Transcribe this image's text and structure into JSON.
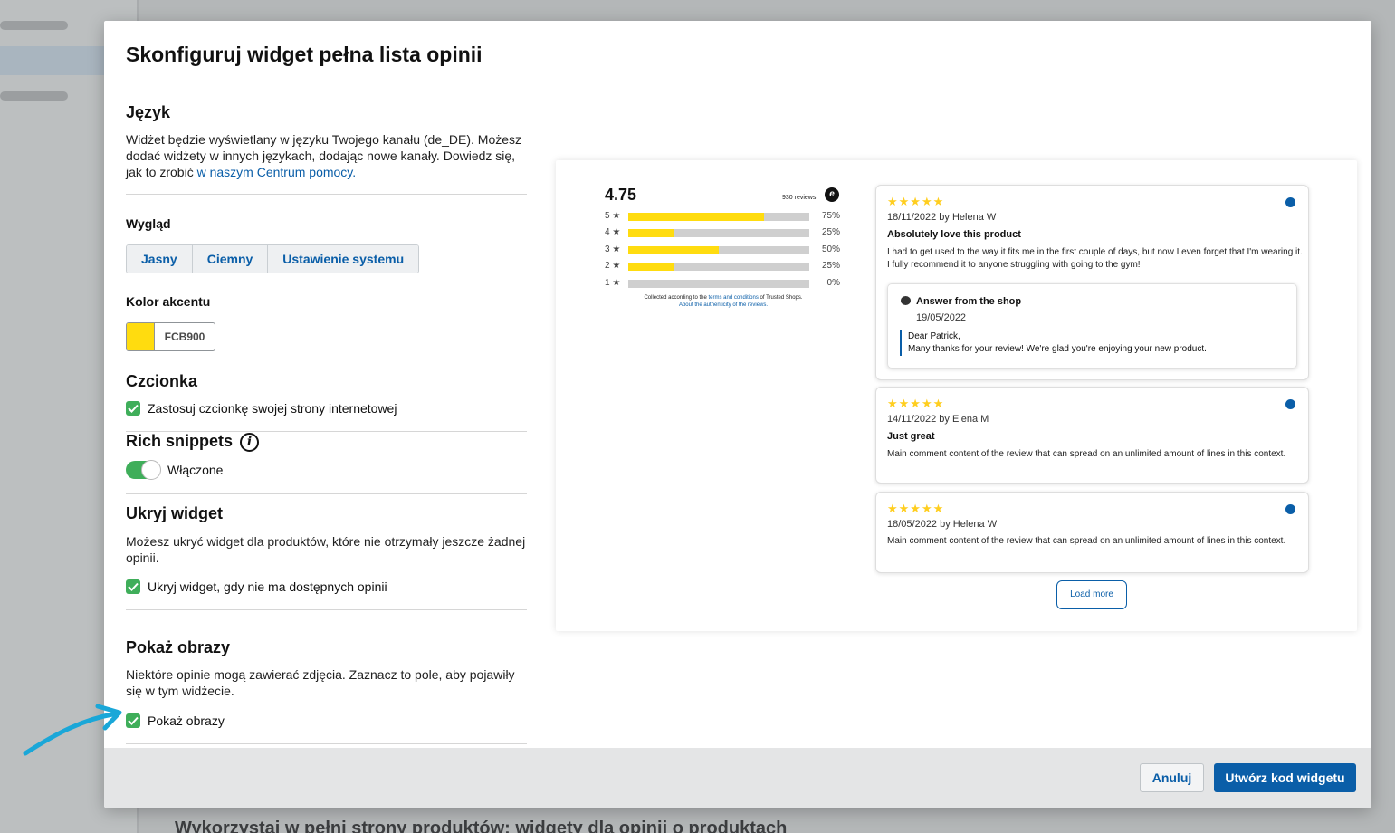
{
  "modal": {
    "title": "Skonfiguruj widget pełna lista opinii",
    "language": {
      "heading": "Język",
      "text": "Widżet będzie wyświetlany w języku Twojego kanału (de_DE). Możesz dodać widżety w innych językach, dodając nowe kanały. Dowiedz się, jak to zrobić ",
      "link": "w naszym Centrum pomocy."
    },
    "appearance": {
      "heading": "Wygląd",
      "options": [
        "Jasny",
        "Ciemny",
        "Ustawienie systemu"
      ]
    },
    "accent": {
      "heading": "Kolor akcentu",
      "value": "FCB900",
      "swatch_color": "#FCB900"
    },
    "font": {
      "heading": "Czcionka",
      "checkbox_label": "Zastosuj czcionkę swojej strony internetowej",
      "checked": true
    },
    "rich_snippets": {
      "heading": "Rich snippets",
      "info_icon": "info-icon",
      "toggle_label": "Włączone",
      "enabled": true
    },
    "hide_widget": {
      "heading": "Ukryj widget",
      "text": "Możesz ukryć widget dla produktów, które nie otrzymały jeszcze żadnej opinii.",
      "checkbox_label": "Ukryj widget, gdy nie ma dostępnych opinii",
      "checked": true
    },
    "show_images": {
      "heading": "Pokaż obrazy",
      "text": "Niektóre opinie mogą zawierać zdjęcia. Zaznacz to pole, aby pojawiły się w tym widżecie.",
      "checkbox_label": "Pokaż obrazy",
      "checked": true
    },
    "footer": {
      "cancel": "Anuluj",
      "create": "Utwórz kod widgetu"
    }
  },
  "preview": {
    "score": "4.75",
    "count": "930 reviews",
    "distribution": [
      {
        "label": "5 ★",
        "fraction": 0.75,
        "pct": "75%"
      },
      {
        "label": "4 ★",
        "fraction": 0.25,
        "pct": "25%"
      },
      {
        "label": "3 ★",
        "fraction": 0.5,
        "pct": "50%"
      },
      {
        "label": "2 ★",
        "fraction": 0.25,
        "pct": "25%"
      },
      {
        "label": "1 ★",
        "fraction": 0.0,
        "pct": "0%"
      }
    ],
    "collected_prefix": "Collected according to the ",
    "collected_link": "terms and conditions",
    "collected_suffix": " of Trusted Shops.",
    "authenticity_link": "About the authenticity of the reviews.",
    "reviews": [
      {
        "stars": "★★★★★",
        "meta": "18/11/2022 by Helena W",
        "title": "Absolutely love this product",
        "body": "I had to get used to the way it fits me in the first couple of days, but now I even forget that I'm wearing it. I fully recommend it to anyone struggling with going to the gym!",
        "answer": {
          "title": "Answer from the shop",
          "date": "19/05/2022",
          "line1": "Dear Patrick,",
          "line2": "Many thanks for your review! We're glad you're enjoying your new product."
        }
      },
      {
        "stars": "★★★★★",
        "meta": "14/11/2022 by Elena M",
        "title": "Just great",
        "body": "Main comment content of the review that can spread on an unlimited amount of lines in this context."
      },
      {
        "stars": "★★★★★",
        "meta": "18/05/2022 by Helena W",
        "body": "Main comment content of the review that can spread on an unlimited amount of lines in this context."
      }
    ],
    "load_more": "Load more"
  },
  "background": {
    "heading": "Wykorzystaj w pełni strony produktów: widgety dla opinii o produktach"
  }
}
